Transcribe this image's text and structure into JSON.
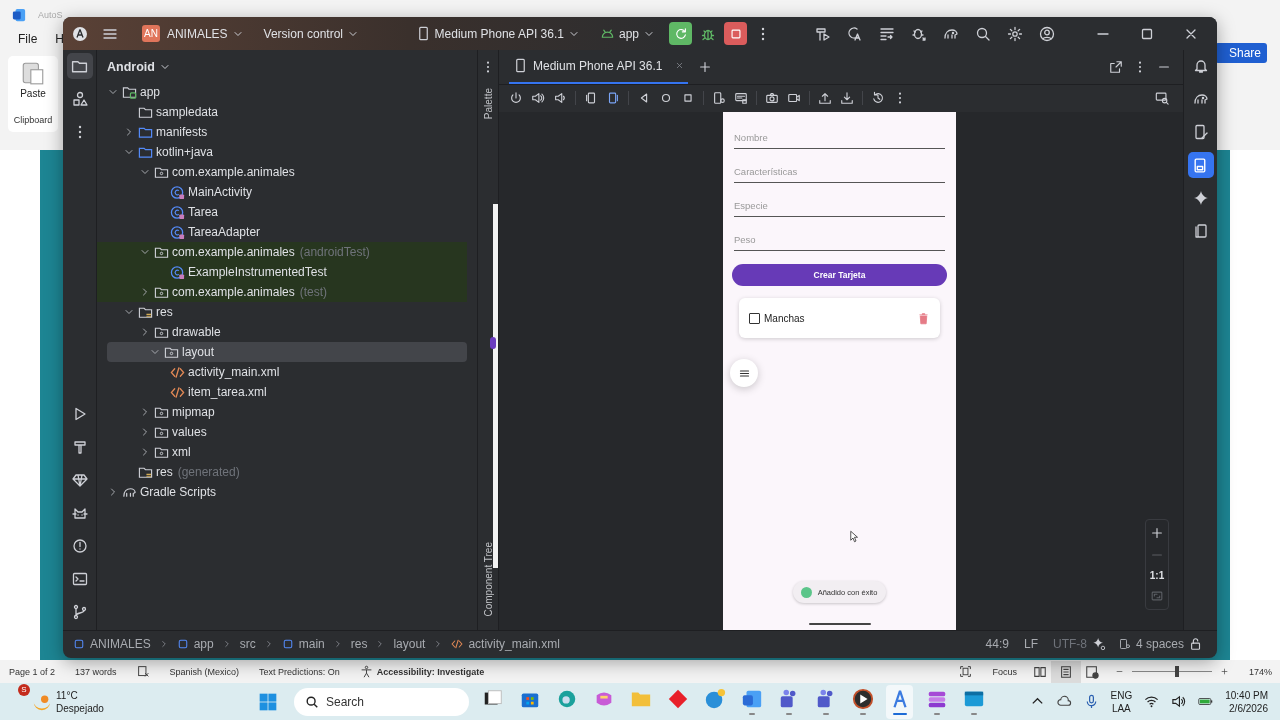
{
  "word": {
    "autosave": "AutoS",
    "menu": [
      "File",
      "H"
    ],
    "paste": "Paste",
    "group": "Clipboard",
    "share": "Share"
  },
  "ide": {
    "title_bar": {
      "project_badge": "AN",
      "project": "ANIMALES",
      "version_control": "Version control",
      "device": "Medium Phone API 36.1",
      "run_config": "app"
    },
    "project_panel": {
      "view": "Android",
      "tree": [
        {
          "label": "app",
          "kind": "module",
          "expanded": true,
          "selected": false,
          "children": [
            {
              "label": "sampledata",
              "kind": "folder",
              "selected": false
            },
            {
              "label": "manifests",
              "kind": "source",
              "expanded": false,
              "selected": false
            },
            {
              "label": "kotlin+java",
              "kind": "source",
              "expanded": true,
              "selected": false,
              "children": [
                {
                  "label": "com.example.animales",
                  "kind": "package",
                  "expanded": true,
                  "selected": false,
                  "children": [
                    {
                      "label": "MainActivity",
                      "kind": "class",
                      "selected": false
                    },
                    {
                      "label": "Tarea",
                      "kind": "class",
                      "selected": false
                    },
                    {
                      "label": "TareaAdapter",
                      "kind": "class",
                      "selected": false
                    }
                  ]
                },
                {
                  "label": "com.example.animales",
                  "suffix": "(androidTest)",
                  "kind": "package",
                  "expanded": true,
                  "selected": false,
                  "test": true,
                  "children": [
                    {
                      "label": "ExampleInstrumentedTest",
                      "kind": "class",
                      "selected": false,
                      "test": true
                    }
                  ]
                },
                {
                  "label": "com.example.animales",
                  "suffix": "(test)",
                  "kind": "package",
                  "expanded": false,
                  "selected": false,
                  "test": true
                }
              ]
            },
            {
              "label": "res",
              "kind": "res",
              "expanded": true,
              "selected": false,
              "children": [
                {
                  "label": "drawable",
                  "kind": "package",
                  "expanded": false,
                  "selected": false
                },
                {
                  "label": "layout",
                  "kind": "package",
                  "expanded": true,
                  "selected": true,
                  "children": [
                    {
                      "label": "activity_main.xml",
                      "kind": "xml",
                      "selected": false
                    },
                    {
                      "label": "item_tarea.xml",
                      "kind": "xml",
                      "selected": false
                    }
                  ]
                },
                {
                  "label": "mipmap",
                  "kind": "package",
                  "expanded": false,
                  "selected": false
                },
                {
                  "label": "values",
                  "kind": "package",
                  "expanded": false,
                  "selected": false
                },
                {
                  "label": "xml",
                  "kind": "package",
                  "expanded": false,
                  "selected": false
                }
              ]
            },
            {
              "label": "res",
              "suffix": "(generated)",
              "kind": "res",
              "selected": false
            }
          ]
        },
        {
          "label": "Gradle Scripts",
          "kind": "gradle",
          "expanded": false,
          "selected": false
        }
      ]
    },
    "side_labels": {
      "top": "Palette",
      "bottom": "Component Tree"
    },
    "emulator": {
      "tabs": [
        {
          "label": "Medium Phone API 36.1",
          "selected": true
        }
      ],
      "phone": {
        "fields": [
          {
            "placeholder": "Nombre"
          },
          {
            "placeholder": "Características"
          },
          {
            "placeholder": "Especie"
          },
          {
            "placeholder": "Peso"
          }
        ],
        "button": "Crear Tarjeta",
        "items": [
          {
            "label": "Manchas",
            "checked": false
          }
        ],
        "toast": "Añadido con éxito"
      },
      "zoom_reset": "1:1"
    },
    "breadcrumbs": [
      {
        "label": "ANIMALES",
        "kind": "module"
      },
      {
        "label": "app",
        "kind": "module"
      },
      {
        "label": "src",
        "kind": "folder"
      },
      {
        "label": "main",
        "kind": "module"
      },
      {
        "label": "res",
        "kind": "folder"
      },
      {
        "label": "layout",
        "kind": "folder"
      },
      {
        "label": "activity_main.xml",
        "kind": "xml"
      }
    ],
    "status": {
      "caret": "44:9",
      "line_separator": "LF",
      "encoding": "UTF-8",
      "indent": "4 spaces"
    }
  },
  "word_status": {
    "page": "Page 1 of 2",
    "words": "137 words",
    "language": "Spanish (Mexico)",
    "predictions": "Text Predictions: On",
    "accessibility": "Accessibility: Investigate",
    "focus": "Focus",
    "views": [
      {
        "kind": "read",
        "selected": false
      },
      {
        "kind": "print",
        "selected": true
      },
      {
        "kind": "web",
        "selected": false
      }
    ],
    "zoom_slider": {
      "level": 0.56
    },
    "zoom": "174%"
  },
  "taskbar": {
    "weather": {
      "badge": "S",
      "temperature": "11°C",
      "condition": "Despejado"
    },
    "search": {
      "placeholder": "Search"
    },
    "apps": [
      {
        "kind": "taskview",
        "running": false,
        "selected": false
      },
      {
        "kind": "store",
        "running": false,
        "selected": false
      },
      {
        "kind": "browser",
        "running": false,
        "selected": false
      },
      {
        "kind": "copilot",
        "running": false,
        "selected": false
      },
      {
        "kind": "folder",
        "running": false,
        "selected": false
      },
      {
        "kind": "diamond",
        "running": false,
        "selected": false
      },
      {
        "kind": "help",
        "running": false,
        "selected": false
      },
      {
        "kind": "word",
        "running": true,
        "selected": false
      },
      {
        "kind": "teams",
        "running": true,
        "selected": false
      },
      {
        "kind": "teams-work",
        "running": true,
        "selected": false
      },
      {
        "kind": "player",
        "running": true,
        "selected": false
      },
      {
        "kind": "studio",
        "running": true,
        "selected": true
      },
      {
        "kind": "stack",
        "running": true,
        "selected": false
      },
      {
        "kind": "window",
        "running": true,
        "selected": false
      }
    ],
    "tray": {
      "language": "ENG",
      "layout": "LAA",
      "time": "10:40 PM",
      "date": "2/6/2026"
    }
  }
}
